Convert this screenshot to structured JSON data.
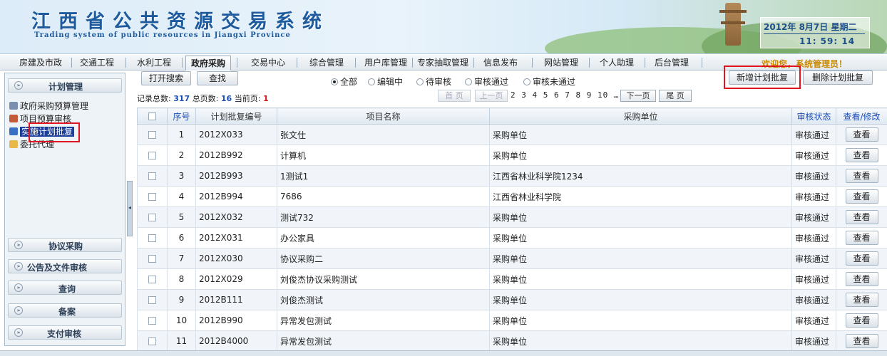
{
  "header": {
    "title_cn": "江西省公共资源交易系统",
    "title_en": "Trading system of public resources in Jiangxi Province",
    "date": "2012年 8月7日 星期二",
    "time": "11: 59: 14",
    "welcome": "欢迎您，系统管理员！"
  },
  "nav": {
    "items": [
      "房建及市政",
      "交通工程",
      "水利工程",
      "政府采购",
      "交易中心",
      "综合管理",
      "用户库管理",
      "专家抽取管理",
      "信息发布",
      "网站管理",
      "个人助理",
      "后台管理"
    ],
    "active": "政府采购"
  },
  "sidebar": {
    "plan_title": "计划管理",
    "plan_items": [
      "政府采购预算管理",
      "项目预算审核",
      "实施计划批复",
      "委托代理"
    ],
    "agreement_title": "协议采购",
    "notice_title": "公告及文件审核",
    "query_title": "查询",
    "filing_title": "备案",
    "payment_title": "支付审核"
  },
  "toolbar": {
    "open_search": "打开搜索",
    "search": "查找",
    "radios": [
      "全部",
      "编辑中",
      "待审核",
      "审核通过",
      "审核未通过"
    ],
    "selected_radio": "全部",
    "add_button": "新增计划批复",
    "delete_button": "删除计划批复"
  },
  "stats": {
    "total_label": "记录总数:",
    "total": "317",
    "pages_label": "总页数:",
    "pages": "16",
    "current_label": "当前页:",
    "current": "1"
  },
  "pager": {
    "first": "首 页",
    "prev": "上一页",
    "numbers": "2 3 4 5 6 7 8 9 10 …",
    "next": "下一页",
    "last": "尾 页"
  },
  "table": {
    "headers": [
      "序号",
      "计划批复编号",
      "项目名称",
      "采购单位",
      "审核状态",
      "查看/修改"
    ],
    "view_label": "查看",
    "rows": [
      {
        "no": "1",
        "code": "2012X033",
        "name": "张文仕",
        "unit": "采购单位",
        "status": "审核通过"
      },
      {
        "no": "2",
        "code": "2012B992",
        "name": "计算机",
        "unit": "采购单位",
        "status": "审核通过"
      },
      {
        "no": "3",
        "code": "2012B993",
        "name": "1测试1",
        "unit": "江西省林业科学院1234",
        "status": "审核通过"
      },
      {
        "no": "4",
        "code": "2012B994",
        "name": "7686",
        "unit": "江西省林业科学院",
        "status": "审核通过"
      },
      {
        "no": "5",
        "code": "2012X032",
        "name": "测试732",
        "unit": "采购单位",
        "status": "审核通过"
      },
      {
        "no": "6",
        "code": "2012X031",
        "name": "办公家具",
        "unit": "采购单位",
        "status": "审核通过"
      },
      {
        "no": "7",
        "code": "2012X030",
        "name": "协议采购二",
        "unit": "采购单位",
        "status": "审核通过"
      },
      {
        "no": "8",
        "code": "2012X029",
        "name": "刘俊杰协议采购测试",
        "unit": "采购单位",
        "status": "审核通过"
      },
      {
        "no": "9",
        "code": "2012B111",
        "name": "刘俊杰测试",
        "unit": "采购单位",
        "status": "审核通过"
      },
      {
        "no": "10",
        "code": "2012B990",
        "name": "异常发包测试",
        "unit": "采购单位",
        "status": "审核通过"
      },
      {
        "no": "11",
        "code": "2012B4000",
        "name": "异常发包测试",
        "unit": "采购单位",
        "status": "审核通过"
      }
    ]
  },
  "colors": {
    "highlight": "#e0141e",
    "accent": "#1c4fb8",
    "selected": "#1c3f9c"
  }
}
